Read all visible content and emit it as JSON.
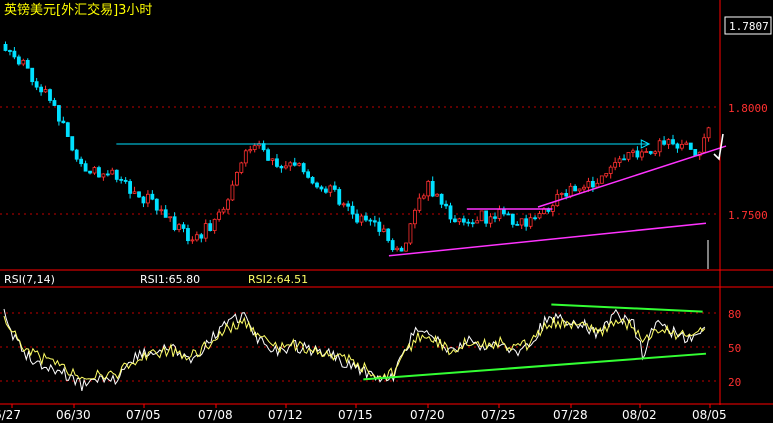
{
  "header": {
    "title": "英镑美元[外汇交易]3小时",
    "last_price": "1.7807"
  },
  "chart_data": [
    {
      "type": "candlestick",
      "title": "英镑美元[外汇交易]3小时",
      "xlabel": "",
      "ylabel": "",
      "ylim": [
        1.716,
        1.838
      ],
      "ytick_labels": [
        "1.8000",
        "1.7500"
      ],
      "ytick_values": [
        1.8,
        1.75
      ],
      "last_price": 1.7807,
      "x_labels": [
        "6/27",
        "06/30",
        "07/05",
        "07/08",
        "07/12",
        "07/15",
        "07/20",
        "07/25",
        "07/28",
        "08/02",
        "08/05"
      ],
      "close_path": [
        [
          0,
          1.826
        ],
        [
          14,
          1.817
        ],
        [
          28,
          1.807
        ],
        [
          45,
          1.794
        ],
        [
          60,
          1.776
        ],
        [
          70,
          1.766
        ],
        [
          85,
          1.763
        ],
        [
          100,
          1.761
        ],
        [
          115,
          1.754
        ],
        [
          130,
          1.749
        ],
        [
          145,
          1.743
        ],
        [
          155,
          1.735
        ],
        [
          170,
          1.729
        ],
        [
          185,
          1.738
        ],
        [
          200,
          1.749
        ],
        [
          215,
          1.77
        ],
        [
          225,
          1.777
        ],
        [
          235,
          1.771
        ],
        [
          248,
          1.765
        ],
        [
          262,
          1.766
        ],
        [
          278,
          1.757
        ],
        [
          292,
          1.754
        ],
        [
          306,
          1.746
        ],
        [
          318,
          1.74
        ],
        [
          330,
          1.738
        ],
        [
          340,
          1.733
        ],
        [
          350,
          1.725
        ],
        [
          356,
          1.722
        ],
        [
          364,
          1.736
        ],
        [
          372,
          1.748
        ],
        [
          380,
          1.756
        ],
        [
          392,
          1.749
        ],
        [
          404,
          1.739
        ],
        [
          416,
          1.736
        ],
        [
          424,
          1.742
        ],
        [
          434,
          1.74
        ],
        [
          446,
          1.744
        ],
        [
          456,
          1.739
        ],
        [
          468,
          1.737
        ],
        [
          478,
          1.741
        ],
        [
          488,
          1.744
        ],
        [
          500,
          1.752
        ],
        [
          512,
          1.754
        ],
        [
          524,
          1.757
        ],
        [
          536,
          1.762
        ],
        [
          548,
          1.766
        ],
        [
          560,
          1.77
        ],
        [
          572,
          1.774
        ],
        [
          582,
          1.773
        ],
        [
          590,
          1.779
        ],
        [
          600,
          1.776
        ],
        [
          610,
          1.776
        ],
        [
          618,
          1.774
        ],
        [
          624,
          1.774
        ],
        [
          632,
          1.782
        ]
      ],
      "annotations": {
        "resistance_line": {
          "color": "#00e0ff",
          "from": [
            101,
            1.777
          ],
          "to": [
            580,
            1.777
          ],
          "arrowhead": true
        },
        "short_resistance": {
          "color": "#ff33ff",
          "from": [
            416,
            1.745
          ],
          "to": [
            493,
            1.745
          ]
        },
        "support_trend_lower": {
          "color": "#ff33ff",
          "from": [
            346,
            1.722
          ],
          "to": [
            631,
            1.738
          ]
        },
        "support_trend_upper": {
          "color": "#ff33ff",
          "from": [
            480,
            1.746
          ],
          "to": [
            649,
            1.776
          ]
        },
        "last_bar_marker": {
          "color": "#ffffff"
        }
      },
      "colors": {
        "up_candle": "#ff3030",
        "down_candle": "#00e0ff",
        "grid": "#ff0000"
      }
    },
    {
      "type": "line",
      "indicator": "RSI(7,14)",
      "ylim": [
        0,
        100
      ],
      "ytick_values": [
        80,
        50,
        20
      ],
      "ytick_labels": [
        "80",
        "50",
        "20"
      ],
      "x_labels": [
        "6/27",
        "06/30",
        "07/05",
        "07/08",
        "07/12",
        "07/15",
        "07/20",
        "07/25",
        "07/28",
        "08/02",
        "08/05"
      ],
      "series": [
        {
          "name": "RSI1:65.80",
          "color": "#ffffff",
          "last_value": 65.8,
          "path": [
            [
              0,
              78
            ],
            [
              8,
              60
            ],
            [
              20,
              42
            ],
            [
              35,
              34
            ],
            [
              55,
              25
            ],
            [
              70,
              16
            ],
            [
              90,
              22
            ],
            [
              100,
              20
            ],
            [
              115,
              38
            ],
            [
              130,
              44
            ],
            [
              150,
              48
            ],
            [
              165,
              36
            ],
            [
              180,
              48
            ],
            [
              200,
              70
            ],
            [
              215,
              76
            ],
            [
              230,
              54
            ],
            [
              245,
              44
            ],
            [
              260,
              50
            ],
            [
              275,
              46
            ],
            [
              290,
              44
            ],
            [
              305,
              36
            ],
            [
              320,
              30
            ],
            [
              335,
              20
            ],
            [
              350,
              24
            ],
            [
              362,
              50
            ],
            [
              372,
              66
            ],
            [
              386,
              56
            ],
            [
              400,
              44
            ],
            [
              416,
              54
            ],
            [
              430,
              50
            ],
            [
              445,
              54
            ],
            [
              460,
              42
            ],
            [
              475,
              54
            ],
            [
              490,
              76
            ],
            [
              505,
              72
            ],
            [
              520,
              68
            ],
            [
              535,
              60
            ],
            [
              550,
              76
            ],
            [
              565,
              70
            ],
            [
              575,
              40
            ],
            [
              585,
              68
            ],
            [
              600,
              62
            ],
            [
              615,
              55
            ],
            [
              630,
              65.8
            ]
          ]
        },
        {
          "name": "RSI2:64.51",
          "color": "#ffff66",
          "last_value": 64.51,
          "path": [
            [
              0,
              72
            ],
            [
              10,
              58
            ],
            [
              22,
              45
            ],
            [
              38,
              37
            ],
            [
              56,
              30
            ],
            [
              72,
              22
            ],
            [
              90,
              25
            ],
            [
              100,
              24
            ],
            [
              115,
              36
            ],
            [
              130,
              42
            ],
            [
              150,
              46
            ],
            [
              165,
              40
            ],
            [
              180,
              48
            ],
            [
              200,
              64
            ],
            [
              215,
              70
            ],
            [
              230,
              56
            ],
            [
              245,
              48
            ],
            [
              260,
              50
            ],
            [
              275,
              47
            ],
            [
              290,
              45
            ],
            [
              305,
              39
            ],
            [
              320,
              33
            ],
            [
              335,
              24
            ],
            [
              350,
              26
            ],
            [
              362,
              44
            ],
            [
              372,
              58
            ],
            [
              386,
              54
            ],
            [
              400,
              47
            ],
            [
              416,
              52
            ],
            [
              430,
              51
            ],
            [
              445,
              53
            ],
            [
              460,
              46
            ],
            [
              475,
              53
            ],
            [
              490,
              70
            ],
            [
              505,
              69
            ],
            [
              520,
              66
            ],
            [
              535,
              61
            ],
            [
              550,
              70
            ],
            [
              565,
              68
            ],
            [
              575,
              50
            ],
            [
              585,
              64
            ],
            [
              600,
              61
            ],
            [
              615,
              58
            ],
            [
              630,
              64.51
            ]
          ]
        }
      ],
      "annotations": {
        "resistance_trend": {
          "color": "#33ff33",
          "from": [
            492,
            85
          ],
          "to": [
            628,
            79
          ]
        },
        "support_trend": {
          "color": "#33ff33",
          "from": [
            323,
            21
          ],
          "to": [
            631,
            43
          ]
        }
      },
      "colors": {
        "grid": "#ff0000"
      }
    }
  ],
  "rsi_panel": {
    "header_label": "RSI(7,14)",
    "rsi1_label": "RSI1:65.80",
    "rsi2_label": "RSI2:64.51"
  },
  "x_axis": {
    "labels": [
      "6/27",
      "06/30",
      "07/05",
      "07/08",
      "07/12",
      "07/15",
      "07/20",
      "07/25",
      "07/28",
      "08/02",
      "08/05"
    ]
  }
}
